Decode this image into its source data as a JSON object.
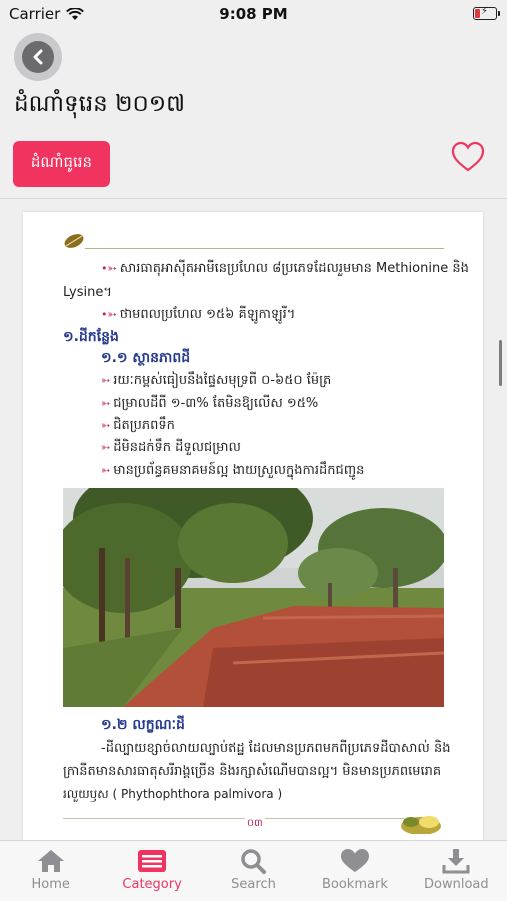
{
  "status_bar": {
    "carrier": "Carrier",
    "time": "9:08 PM"
  },
  "header": {
    "title": "ដំណាំទុរេន ២០១៧",
    "category_label": "ដំណាំធូរេន"
  },
  "document": {
    "lines": [
      "សារធាតុអាស៊ីតអាមីនេប្រហែល ៨ប្រភេទដែលរួមមាន Methionine និង",
      "Lysine។",
      "ថាមពលប្រហែល ១៥៦ គីឡូកាឡូរី។",
      "១.ដីកន្លែង",
      "១.១ ស្ថានភាពដី",
      "រយៈកម្ពស់ធៀបនឹងផ្ទៃសមុទ្រពី ០-៦៥០ ម៉ែត្រ",
      "ជម្រាលដីពី ១-៣% តែមិនឱ្យលើស ១៥%",
      "ជិតប្រភពទឹក",
      "ដីមិនដក់ទឹក ដីទួលជម្រាល",
      "មានប្រព័ន្ធគមនាគមន៍ល្អ ងាយស្រួលក្នុងការដឹកជញ្ជូន",
      "១.២ លក្ខណៈដី",
      "-ដីល្បាយខ្សាច់លាយល្បាប់ឥដ្ឋ ដែលមានប្រភពមកពីប្រភេទដីបាសាល់ និង",
      "ក្រានីតមានសារធាតុសរីរាង្គច្រើន និងរក្សាសំណើមបានល្អ។ មិនមានប្រភពមេរោគ",
      "រលួយឫស ( Phythophthora palmivora )"
    ],
    "page_number": "០៣"
  },
  "tabs": [
    {
      "label": "Home",
      "icon": "home-icon"
    },
    {
      "label": "Category",
      "icon": "category-icon"
    },
    {
      "label": "Search",
      "icon": "search-icon"
    },
    {
      "label": "Bookmark",
      "icon": "heart-icon"
    },
    {
      "label": "Download",
      "icon": "download-icon"
    }
  ],
  "colors": {
    "accent": "#f0345f",
    "heading": "#273b8f",
    "bullet": "#c2245a"
  }
}
